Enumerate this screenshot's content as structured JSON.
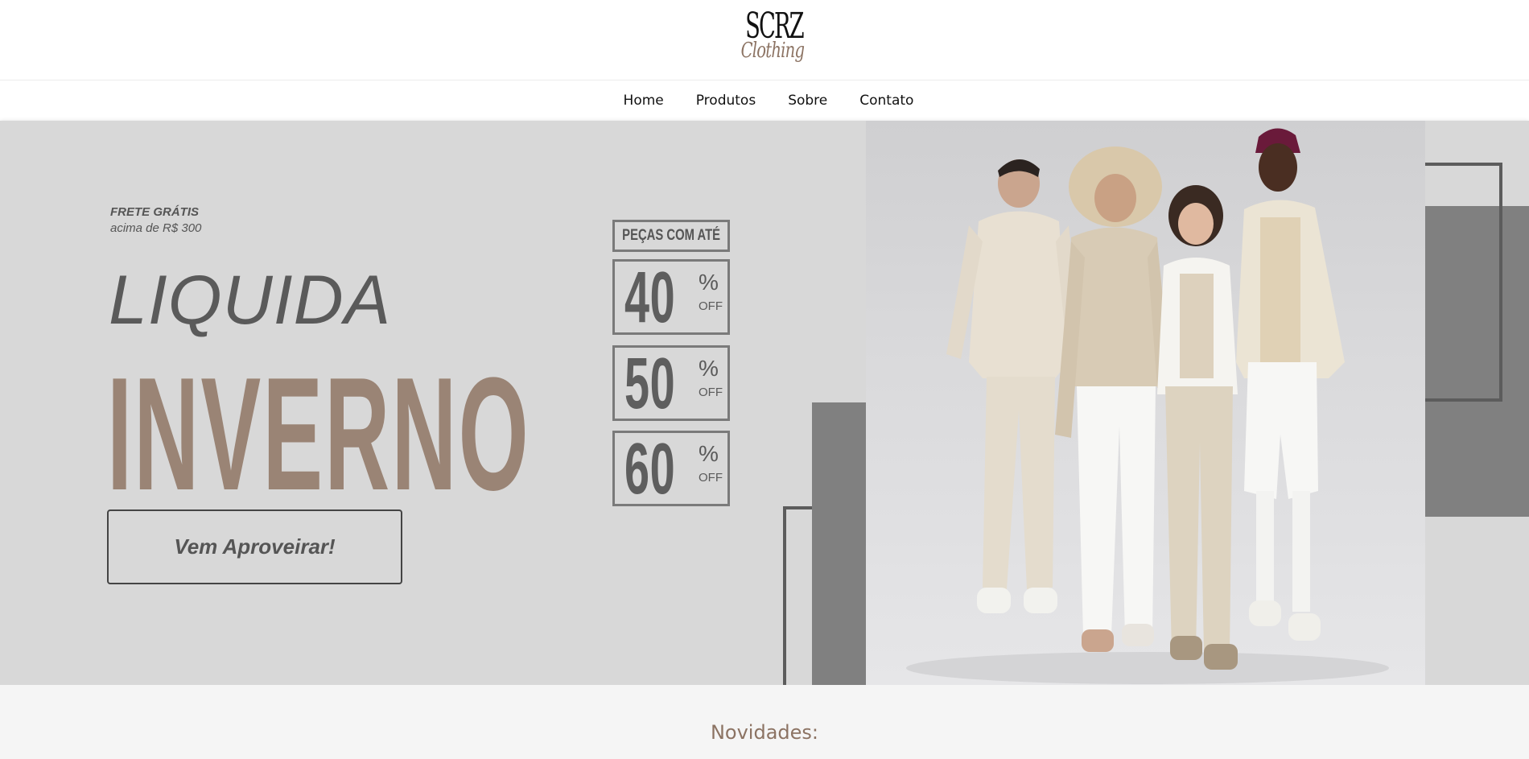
{
  "brand": {
    "logo_top": "SCRZ",
    "logo_bottom": "Clothing"
  },
  "nav": {
    "items": [
      "Home",
      "Produtos",
      "Sobre",
      "Contato"
    ]
  },
  "banner": {
    "frete_title": "FRETE GRÁTIS",
    "frete_sub": "acima de R$ 300",
    "liquida": "LIQUIDA",
    "inverno": "INVERNO",
    "cta_label": "Vem Aproveirar!",
    "pecas_label": "PEÇAS COM ATÉ",
    "discounts": [
      {
        "value": "40",
        "pct": "%",
        "off": "OFF"
      },
      {
        "value": "50",
        "pct": "%",
        "off": "OFF"
      },
      {
        "value": "60",
        "pct": "%",
        "off": "OFF"
      }
    ],
    "accent_color": "#9a8475"
  },
  "section": {
    "novidades_title": "Novidades:"
  }
}
